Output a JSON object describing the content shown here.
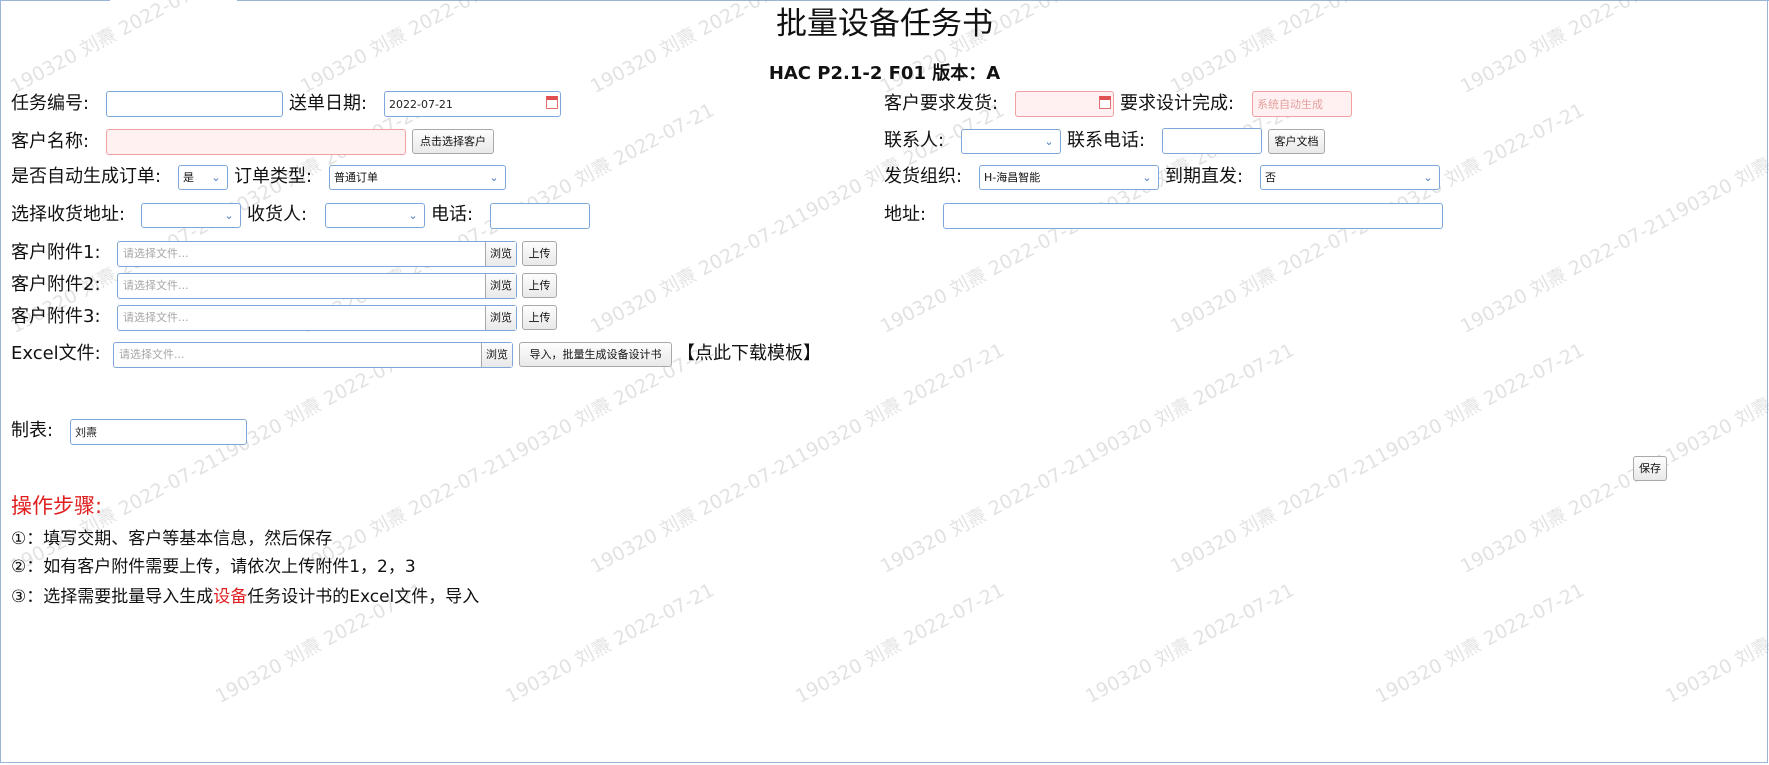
{
  "header": {
    "title": "批量设备任务书",
    "subtitle": "HAC P2.1-2 F01 版本：A"
  },
  "form": {
    "task_no": {
      "label": "任务编号:",
      "value": ""
    },
    "send_date": {
      "label": "送单日期:",
      "value": "2022-07-21"
    },
    "req_ship": {
      "label": "客户要求发货:",
      "value": ""
    },
    "req_design": {
      "label": "要求设计完成:",
      "placeholder": "系统自动生成"
    },
    "customer_name": {
      "label": "客户名称:",
      "value": ""
    },
    "select_customer_button": "点击选择客户",
    "contact": {
      "label": "联系人:",
      "value": ""
    },
    "contact_phone": {
      "label": "联系电话:",
      "value": ""
    },
    "customer_docs_button": "客户文档",
    "auto_order": {
      "label": "是否自动生成订单:",
      "value": "是"
    },
    "order_type": {
      "label": "订单类型:",
      "value": "普通订单"
    },
    "ship_org": {
      "label": "发货组织:",
      "value": "H-海昌智能"
    },
    "due_direct": {
      "label": "到期直发:",
      "value": "否"
    },
    "select_address": {
      "label": "选择收货地址:",
      "value": ""
    },
    "receiver": {
      "label": "收货人:",
      "value": ""
    },
    "phone": {
      "label": "电话:",
      "value": ""
    },
    "address": {
      "label": "地址:",
      "value": ""
    },
    "attachments": [
      {
        "label": "客户附件1:",
        "placeholder": "请选择文件...",
        "browse": "浏览",
        "upload": "上传"
      },
      {
        "label": "客户附件2:",
        "placeholder": "请选择文件...",
        "browse": "浏览",
        "upload": "上传"
      },
      {
        "label": "客户附件3:",
        "placeholder": "请选择文件...",
        "browse": "浏览",
        "upload": "上传"
      }
    ],
    "excel": {
      "label": "Excel文件:",
      "placeholder": "请选择文件...",
      "browse": "浏览",
      "import_button": "导入，批量生成设备设计书",
      "download_link": "【点此下载模板】"
    },
    "maker": {
      "label": "制表:",
      "value": "刘燾"
    },
    "save_button": "保存"
  },
  "steps": {
    "title": "操作步骤:",
    "items": [
      "①：填写交期、客户等基本信息，然后保存",
      "②：如有客户附件需要上传，请依次上传附件1，2，3"
    ],
    "step3": {
      "prefix": "③：选择需要批量导入生成",
      "highlight": "设备",
      "suffix": "任务设计书的Excel文件，导入"
    }
  },
  "watermark": "190320 刘燾 2022-07-21",
  "colors": {
    "accent_border": "#7fa7da",
    "required_bg": "#fff1f1",
    "steps_red": "#e02020"
  }
}
